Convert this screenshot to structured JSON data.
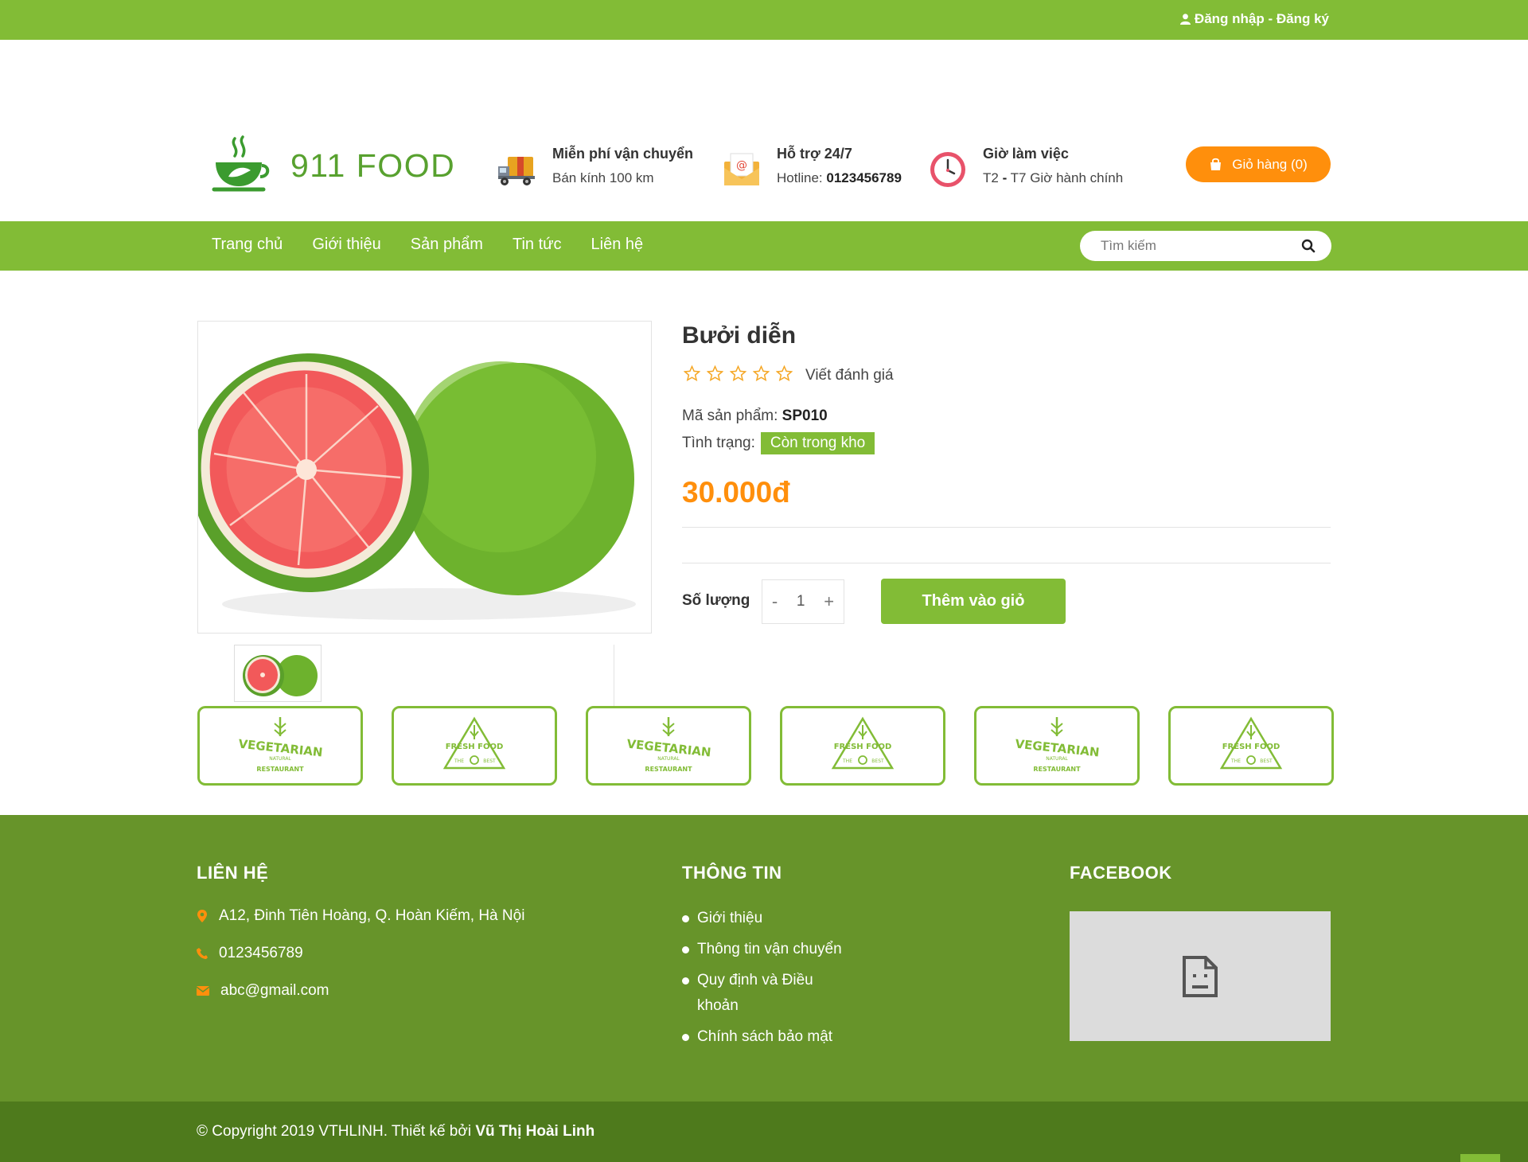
{
  "topbar": {
    "auth_text": "Đăng nhập - Đăng ký"
  },
  "logo": {
    "text": "911 FOOD"
  },
  "header_info": [
    {
      "title": "Miễn phí vận chuyển",
      "subtitle": "Bán kính 100 km"
    },
    {
      "title": "Hỗ trợ 24/7",
      "subtitle_prefix": "Hotline: ",
      "subtitle_bold": "0123456789"
    },
    {
      "title": "Giờ làm việc",
      "subtitle_prefix": "T2 ",
      "subtitle_bold": "-",
      "subtitle_suffix": " T7 Giờ hành chính"
    }
  ],
  "cart": {
    "label": "Giỏ hàng (0)"
  },
  "nav": {
    "items": [
      "Trang chủ",
      "Giới thiệu",
      "Sản phẩm",
      "Tin tức",
      "Liên hệ"
    ]
  },
  "search": {
    "placeholder": "Tìm kiếm",
    "value": ""
  },
  "product": {
    "name": "Bưởi diễn",
    "rating": 0,
    "rating_max": 5,
    "review_link": "Viết đánh giá",
    "sku_label": "Mã sản phẩm: ",
    "sku": "SP010",
    "stock_label": "Tình trạng: ",
    "stock_value": "Còn trong kho",
    "price": "30.000đ",
    "qty_label": "Số lượng",
    "qty_value": "1",
    "minus": "-",
    "plus": "+",
    "add_to_cart": "Thêm vào giỏ"
  },
  "brands": [
    "vegetarian-logo",
    "fresh-food-logo",
    "vegetarian-logo",
    "fresh-food-logo",
    "vegetarian-logo",
    "fresh-food-logo"
  ],
  "footer": {
    "contact_title": "LIÊN HỆ",
    "address": "A12, Đinh Tiên Hoàng, Q. Hoàn Kiếm, Hà Nội",
    "phone": "0123456789",
    "email": "abc@gmail.com",
    "info_title": "THÔNG TIN",
    "info_links": [
      "Giới thiệu",
      "Thông tin vận chuyển",
      "Quy định và Điều khoản",
      "Chính sách bảo mật"
    ],
    "facebook_title": "FACEBOOK"
  },
  "copyright": {
    "prefix": "© Copyright 2019 VTHLINH. Thiết kế bởi ",
    "author": "Vũ Thị Hoài Linh"
  },
  "colors": {
    "primary": "#82bc36",
    "accent": "#ff8f0c",
    "footer": "#67942a",
    "footer_bottom": "#4e7a1c"
  }
}
